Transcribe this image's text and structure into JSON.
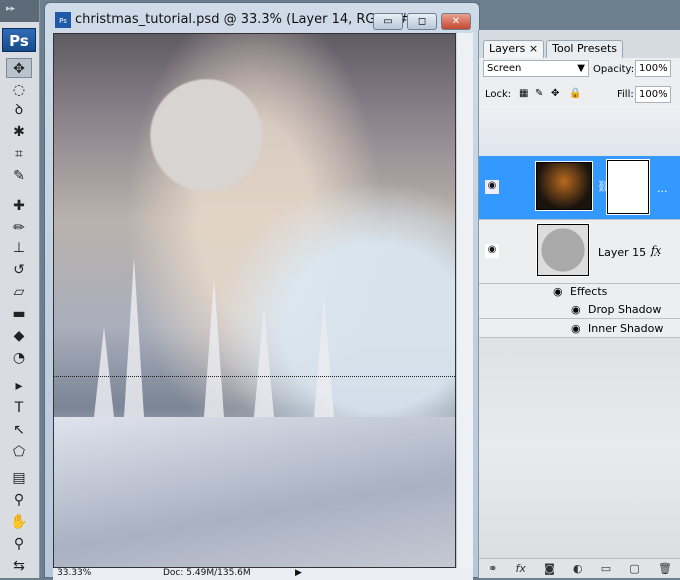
{
  "app": {
    "logo": "Ps"
  },
  "document": {
    "title": "christmas_tutorial.psd @ 33.3% (Layer 14, RGB/8#)",
    "zoom": "33.33%",
    "doc_info": "Doc: 5.49M/135.6M"
  },
  "window_buttons": {
    "minimize": "▭",
    "maximize": "◻",
    "close": "✕"
  },
  "tools": [
    {
      "name": "move-tool",
      "glyph": "✥"
    },
    {
      "name": "marquee-tool",
      "glyph": "◌"
    },
    {
      "name": "lasso-tool",
      "glyph": "ꝺ"
    },
    {
      "name": "magic-wand-tool",
      "glyph": "✱"
    },
    {
      "name": "crop-tool",
      "glyph": "⌗"
    },
    {
      "name": "eyedropper-tool",
      "glyph": "✎"
    },
    {
      "name": "healing-tool",
      "glyph": "✚"
    },
    {
      "name": "brush-tool",
      "glyph": "✏"
    },
    {
      "name": "stamp-tool",
      "glyph": "⊥"
    },
    {
      "name": "history-brush-tool",
      "glyph": "↺"
    },
    {
      "name": "eraser-tool",
      "glyph": "▱"
    },
    {
      "name": "gradient-tool",
      "glyph": "▬"
    },
    {
      "name": "blur-tool",
      "glyph": "◆"
    },
    {
      "name": "dodge-tool",
      "glyph": "◔"
    },
    {
      "name": "path-select-tool",
      "glyph": "▸"
    },
    {
      "name": "type-tool",
      "glyph": "T"
    },
    {
      "name": "direct-select-tool",
      "glyph": "↖"
    },
    {
      "name": "shape-tool",
      "glyph": "⬠"
    },
    {
      "name": "notes-tool",
      "glyph": "▤"
    },
    {
      "name": "color-sampler-tool",
      "glyph": "⚲"
    },
    {
      "name": "hand-tool",
      "glyph": "✋"
    },
    {
      "name": "zoom-tool",
      "glyph": "⚲"
    },
    {
      "name": "swap-colors",
      "glyph": "⇆"
    }
  ],
  "layers_panel": {
    "tabs": [
      {
        "label": "Layers ×"
      },
      {
        "label": "Tool Presets"
      }
    ],
    "blend_mode": "Screen",
    "opacity_label": "Opacity:",
    "opacity": "100%",
    "lock_label": "Lock:",
    "fill_label": "Fill:",
    "fill": "100%",
    "layers": [
      {
        "name": "...",
        "selected": true
      },
      {
        "name": "Layer 15 ...",
        "fx": "fx",
        "effects_label": "Effects",
        "effects": [
          "Drop Shadow",
          "Inner Shadow"
        ]
      }
    ],
    "bottom_icons": [
      "⚭",
      "fx",
      "◙",
      "◐",
      "▭",
      "▢",
      "🗑"
    ]
  },
  "colors": {
    "selected_layer": "#3399ff"
  }
}
